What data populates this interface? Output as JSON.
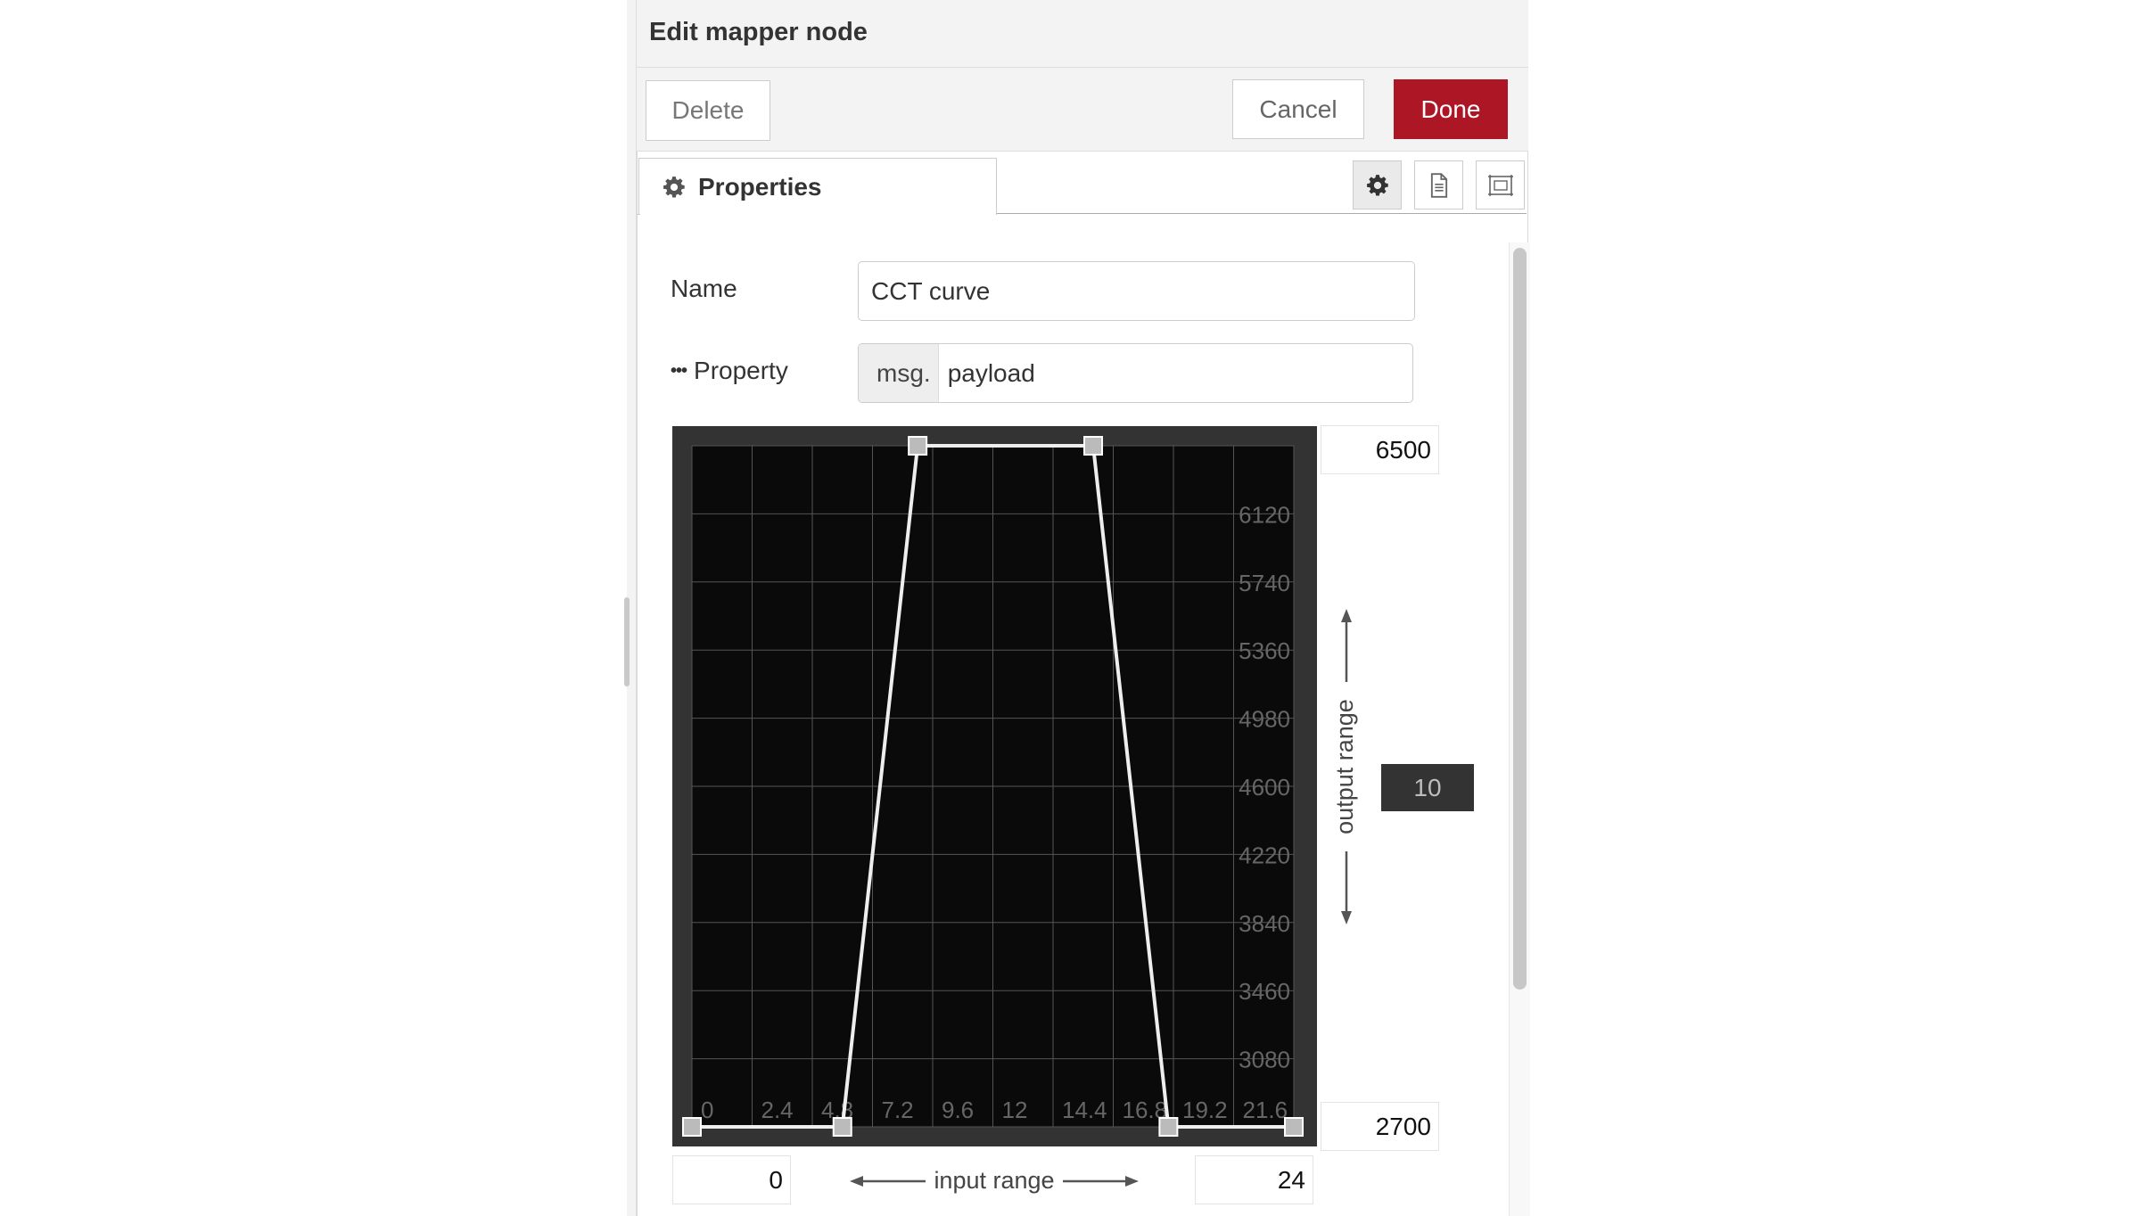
{
  "editor": {
    "title": "Edit mapper node",
    "buttons": {
      "delete": "Delete",
      "cancel": "Cancel",
      "done": "Done"
    },
    "tabs": [
      {
        "label": "Properties",
        "icon": "gear-icon"
      }
    ],
    "tab_icons": [
      "gear-icon",
      "document-icon",
      "frame-icon"
    ],
    "accent_color": "#ad1625"
  },
  "form": {
    "name_label": "Name",
    "name_value": "CCT curve",
    "property_label": "Property",
    "property_prefix": "msg.",
    "property_value": "payload"
  },
  "mapper": {
    "output_max": "6500",
    "output_min": "2700",
    "input_min": "0",
    "input_max": "24",
    "output_range_label": "output range",
    "input_range_label": "input range",
    "step_value": "10"
  },
  "chart_data": {
    "type": "line",
    "x_ticks": [
      "0",
      "2.4",
      "4.8",
      "7.2",
      "9.6",
      "12",
      "14.4",
      "16.8",
      "19.2",
      "21.6"
    ],
    "y_ticks": [
      "3080",
      "3460",
      "3840",
      "4220",
      "4600",
      "4980",
      "5360",
      "5740",
      "6120"
    ],
    "xlim": [
      0,
      24
    ],
    "ylim": [
      2700,
      6500
    ],
    "grid": true,
    "series": [
      {
        "x": [
          0,
          6,
          9,
          16,
          19,
          24
        ],
        "y": [
          2700,
          2700,
          6500,
          6500,
          2700,
          2700
        ]
      }
    ],
    "colors": {
      "background": "#0a0a0a",
      "frame": "#333333",
      "grid": "#555555",
      "line": "#eeeeee",
      "handle": "#bbbbbb",
      "tick": "#666666"
    }
  }
}
